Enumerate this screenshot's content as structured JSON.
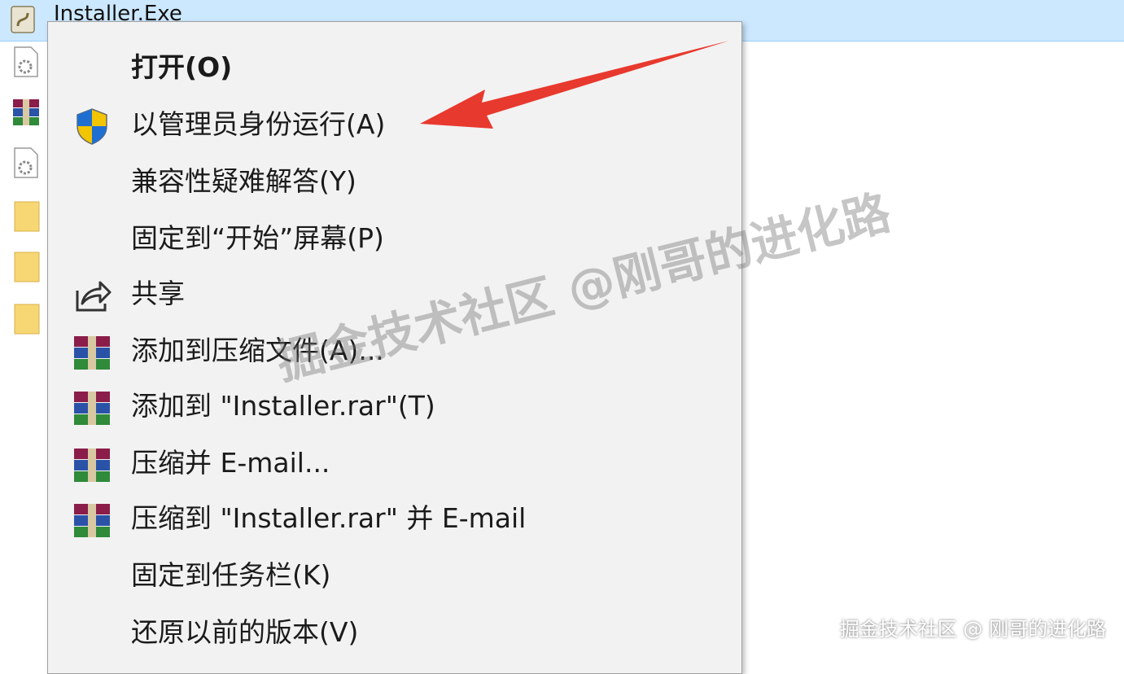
{
  "explorer": {
    "selected_file": "Installer.Exe"
  },
  "context_menu": {
    "items": [
      {
        "label": "打开(O)",
        "icon": "",
        "bold": true
      },
      {
        "label": "以管理员身份运行(A)",
        "icon": "uac-shield-icon"
      },
      {
        "label": "兼容性疑难解答(Y)",
        "icon": ""
      },
      {
        "label": "固定到“开始”屏幕(P)",
        "icon": ""
      },
      {
        "label": "共享",
        "icon": "share-icon"
      },
      {
        "label": "添加到压缩文件(A)...",
        "icon": "winrar-icon"
      },
      {
        "label": "添加到 \"Installer.rar\"(T)",
        "icon": "winrar-icon"
      },
      {
        "label": "压缩并 E-mail...",
        "icon": "winrar-icon"
      },
      {
        "label": "压缩到 \"Installer.rar\" 并 E-mail",
        "icon": "winrar-icon"
      },
      {
        "label": "固定到任务栏(K)",
        "icon": ""
      },
      {
        "label": "还原以前的版本(V)",
        "icon": ""
      }
    ]
  },
  "watermark": {
    "center": "掘金技术社区 @刚哥的进化路",
    "corner": "掘金技术社区 @ 刚哥的进化路"
  },
  "colors": {
    "selection": "#cce8ff",
    "menu_bg": "#f2f2f2",
    "arrow": "#e8392e"
  }
}
